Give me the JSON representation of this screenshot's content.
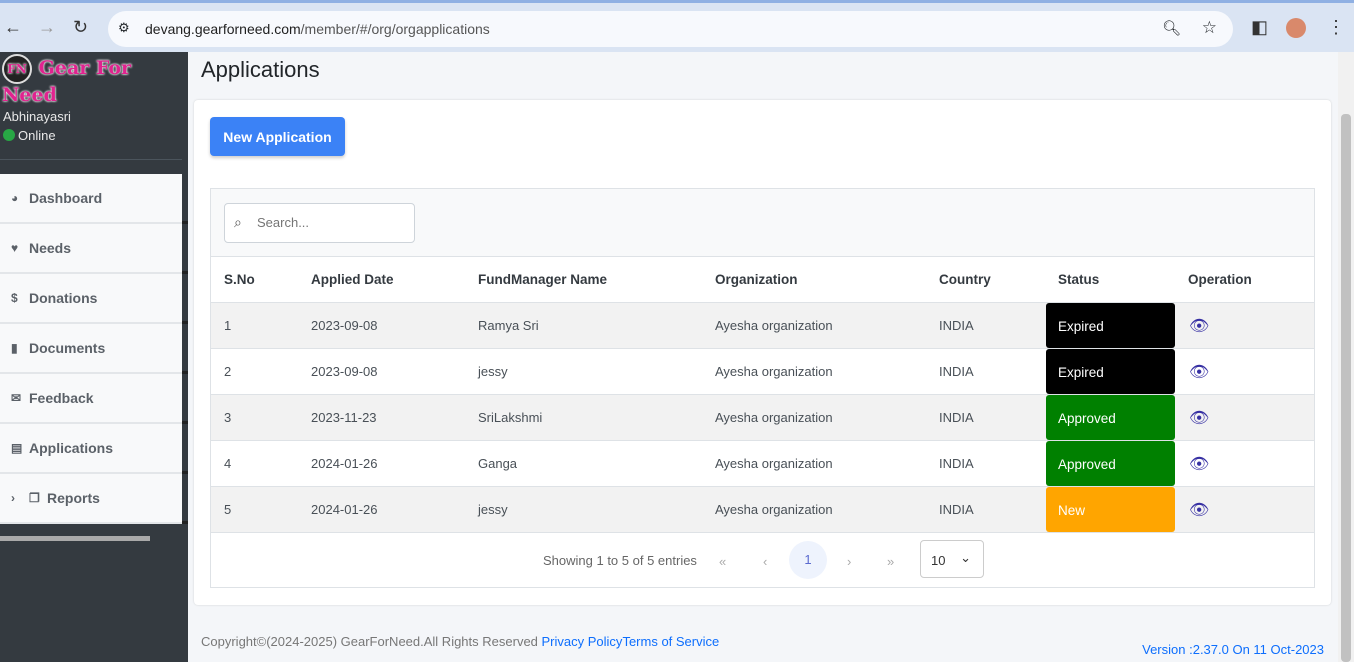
{
  "browser": {
    "url_host": "devang.gearforneed.com",
    "url_path": "/member/#/org/orgapplications"
  },
  "sidebar": {
    "logo": "Gear For Need",
    "logo_mark": "FN",
    "user": "Abhinayasri",
    "status": "Online",
    "items": [
      {
        "label": "Dashboard",
        "icon": "pie-chart-icon",
        "glyph": "◕"
      },
      {
        "label": "Needs",
        "icon": "hand-heart-icon",
        "glyph": "♥"
      },
      {
        "label": "Donations",
        "icon": "dollar-icon",
        "glyph": "$"
      },
      {
        "label": "Documents",
        "icon": "file-icon",
        "glyph": "▮"
      },
      {
        "label": "Feedback",
        "icon": "envelope-icon",
        "glyph": "✉"
      },
      {
        "label": "Applications",
        "icon": "file-text-icon",
        "glyph": "▤"
      },
      {
        "label": "Reports",
        "icon": "copy-icon",
        "glyph": "❐"
      }
    ]
  },
  "page": {
    "title": "Applications",
    "new_button": "New Application"
  },
  "table": {
    "search_placeholder": "Search...",
    "headers": [
      "S.No",
      "Applied Date",
      "FundManager Name",
      "Organization",
      "Country",
      "Status",
      "Operation"
    ],
    "rows": [
      {
        "sno": "1",
        "date": "2023-09-08",
        "name": "Ramya Sri",
        "org": "Ayesha organization",
        "country": "INDIA",
        "status": "Expired",
        "color": "#000000"
      },
      {
        "sno": "2",
        "date": "2023-09-08",
        "name": "jessy",
        "org": "Ayesha organization",
        "country": "INDIA",
        "status": "Expired",
        "color": "#000000"
      },
      {
        "sno": "3",
        "date": "2023-11-23",
        "name": "SriLakshmi",
        "org": "Ayesha organization",
        "country": "INDIA",
        "status": "Approved",
        "color": "#008000"
      },
      {
        "sno": "4",
        "date": "2024-01-26",
        "name": "Ganga",
        "org": "Ayesha organization",
        "country": "INDIA",
        "status": "Approved",
        "color": "#008000"
      },
      {
        "sno": "5",
        "date": "2024-01-26",
        "name": "jessy",
        "org": "Ayesha organization",
        "country": "INDIA",
        "status": "New",
        "color": "#ffa500"
      }
    ]
  },
  "pagination": {
    "info": "Showing 1 to 5 of 5 entries",
    "first": "«",
    "prev": "‹",
    "page": "1",
    "next": "›",
    "last": "»",
    "page_size": "10"
  },
  "footer": {
    "copyright": "Copyright©(2024-2025) GearForNeed.All Rights Reserved ",
    "privacy": "Privacy Policy",
    "terms": "Terms of Service",
    "version": "Version :2.37.0 On 11 Oct-2023"
  }
}
